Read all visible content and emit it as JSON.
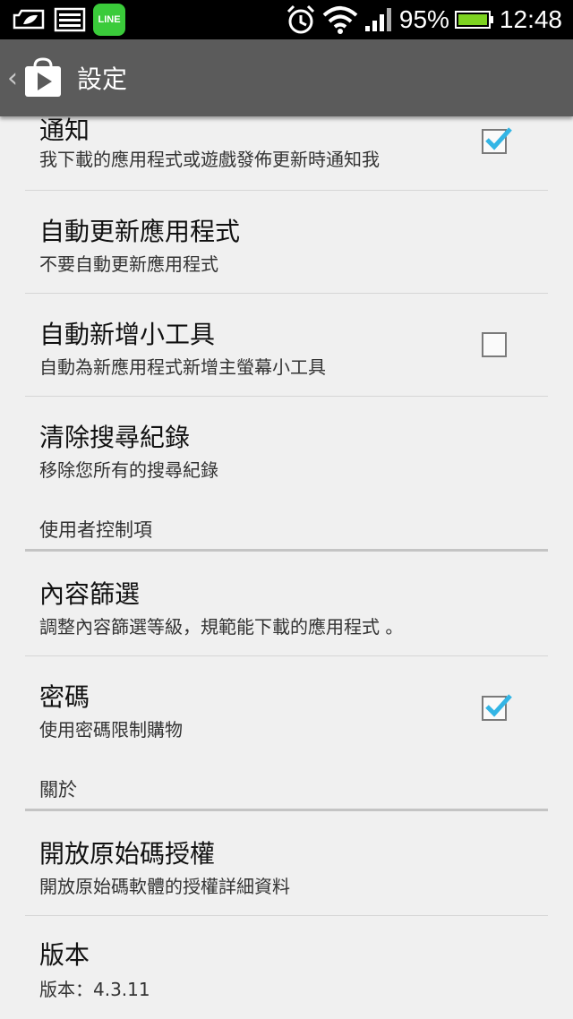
{
  "status_bar": {
    "left_icons": [
      "notification-icon",
      "gallery-icon",
      "line-app-icon"
    ],
    "line_badge": "LINE",
    "battery_percent": "95%",
    "time": "12:48",
    "battery_color": "#7ed321"
  },
  "action_bar": {
    "title": "設定",
    "icon": "play-store-icon",
    "background": "#5b5b5b"
  },
  "settings": {
    "notify": {
      "title": "通知",
      "subtitle": "我下載的應用程式或遊戲發佈更新時通知我",
      "checked": true
    },
    "auto_update": {
      "title": "自動更新應用程式",
      "subtitle": "不要自動更新應用程式"
    },
    "auto_widget": {
      "title": "自動新增小工具",
      "subtitle": "自動為新應用程式新增主螢幕小工具",
      "checked": false
    },
    "clear_history": {
      "title": "清除搜尋紀錄",
      "subtitle": "移除您所有的搜尋紀錄"
    },
    "user_controls_header": "使用者控制項",
    "content_filter": {
      "title": "內容篩選",
      "subtitle": "調整內容篩選等級，規範能下載的應用程式 。"
    },
    "password": {
      "title": "密碼",
      "subtitle": "使用密碼限制購物",
      "checked": true
    },
    "about_header": "關於",
    "open_source": {
      "title": "開放原始碼授權",
      "subtitle": "開放原始碼軟體的授權詳細資料"
    },
    "version": {
      "title": "版本",
      "subtitle": "版本：4.3.11"
    }
  },
  "colors": {
    "check_accent": "#33b5e5",
    "list_background": "#f0f0f0"
  }
}
